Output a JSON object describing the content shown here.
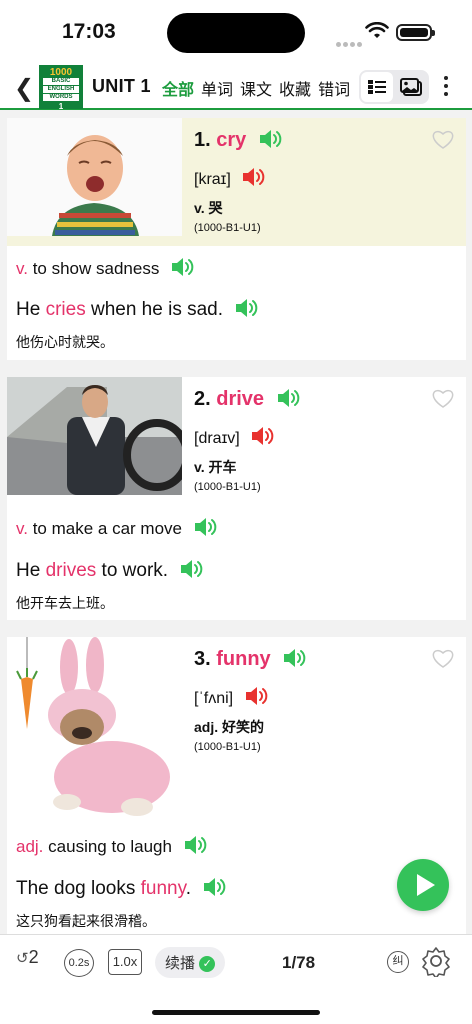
{
  "status": {
    "time": "17:03"
  },
  "nav": {
    "unit": "UNIT 1",
    "book": {
      "number": "1000",
      "line1": "BASIC",
      "line2": "ENGLISH",
      "line3": "WORDS",
      "volume": "1"
    },
    "tabs": [
      {
        "label": "全部",
        "active": true
      },
      {
        "label": "单词",
        "active": false
      },
      {
        "label": "课文",
        "active": false
      },
      {
        "label": "收藏",
        "active": false
      },
      {
        "label": "错词",
        "active": false
      }
    ]
  },
  "cards": [
    {
      "index": "1.",
      "word": "cry",
      "phonetic": "[kraɪ]",
      "pos_zh": "v. 哭",
      "code": "(1000-B1-U1)",
      "def_pos": "v.",
      "def_text": "to show sadness",
      "ex_before": "He ",
      "ex_key": "cries",
      "ex_after": " when he is sad.",
      "zh": "他伤心时就哭。"
    },
    {
      "index": "2.",
      "word": "drive",
      "phonetic": "[draɪv]",
      "pos_zh": "v. 开车",
      "code": "(1000-B1-U1)",
      "def_pos": "v.",
      "def_text": "to make a car move",
      "ex_before": "He ",
      "ex_key": "drives",
      "ex_after": " to work.",
      "zh": "他开车去上班。"
    },
    {
      "index": "3.",
      "word": "funny",
      "phonetic": "[ˈfʌni]",
      "pos_zh": "adj. 好笑的",
      "code": "(1000-B1-U1)",
      "def_pos": "adj.",
      "def_text": "causing to laugh",
      "ex_before": "The dog looks ",
      "ex_key": "funny",
      "ex_after": ".",
      "zh": "这只狗看起来很滑稽。"
    }
  ],
  "bottom": {
    "repeat": "2",
    "interval": "0.2s",
    "speed": "1.0x",
    "continue_label": "续播",
    "pager": "1/78",
    "correct_label": "纠"
  },
  "colors": {
    "accent": "#1c9c3e",
    "keyword": "#e4336a",
    "speaker_green": "#34c25a",
    "speaker_red": "#e8322f"
  }
}
